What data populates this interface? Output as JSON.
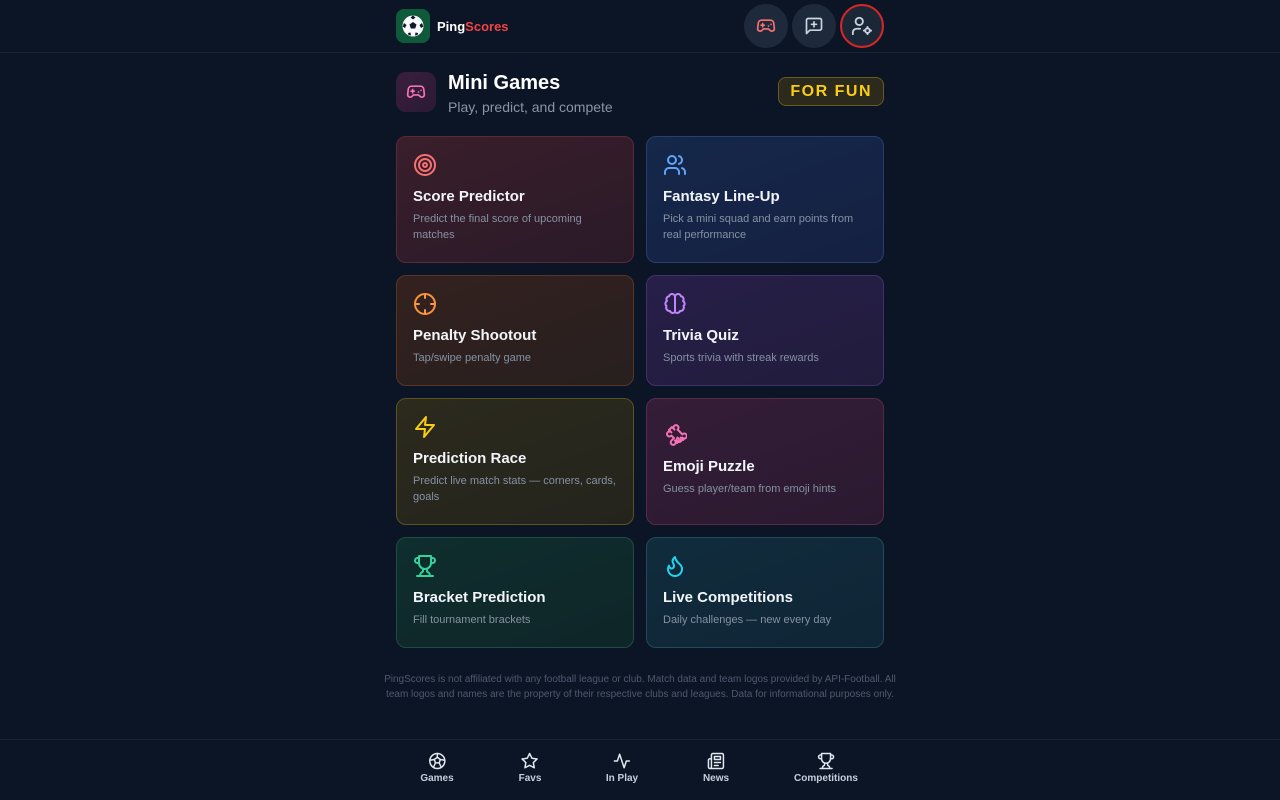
{
  "header": {
    "brand_part1": "Ping",
    "brand_part2": "Scores",
    "actions": [
      {
        "icon": "gamepad-icon",
        "label": ""
      },
      {
        "icon": "message-plus-icon",
        "label": ""
      },
      {
        "icon": "user-settings-icon",
        "label": ""
      }
    ]
  },
  "page": {
    "title": "Mini Games",
    "subtitle": "Play, predict, and compete",
    "badge": "FOR FUN"
  },
  "games": [
    {
      "title": "Score Predictor",
      "description": "Predict the final score of upcoming matches",
      "icon": "target-icon",
      "color": "#f87171"
    },
    {
      "title": "Fantasy Line-Up",
      "description": "Pick a mini squad and earn points from real performance",
      "icon": "users-icon",
      "color": "#60a5fa"
    },
    {
      "title": "Penalty Shootout",
      "description": "Tap/swipe penalty game",
      "icon": "crosshair-icon",
      "color": "#fb923c"
    },
    {
      "title": "Trivia Quiz",
      "description": "Sports trivia with streak rewards",
      "icon": "brain-icon",
      "color": "#c084fc"
    },
    {
      "title": "Prediction Race",
      "description": "Predict live match stats — corners, cards, goals",
      "icon": "zap-icon",
      "color": "#facc15"
    },
    {
      "title": "Emoji Puzzle",
      "description": "Guess player/team from emoji hints",
      "icon": "puzzle-icon",
      "color": "#f472b6"
    },
    {
      "title": "Bracket Prediction",
      "description": "Fill tournament brackets",
      "icon": "trophy-icon",
      "color": "#34d399"
    },
    {
      "title": "Live Competitions",
      "description": "Daily challenges — new every day",
      "icon": "flame-icon",
      "color": "#22d3ee"
    }
  ],
  "disclaimer": "PingScores is not affiliated with any football league or club. Match data and team logos provided by API-Football. All team logos and names are the property of their respective clubs and leagues. Data for informational purposes only.",
  "bottom_nav": [
    {
      "label": "Games",
      "icon": "globe-ball-icon"
    },
    {
      "label": "Favs",
      "icon": "star-icon"
    },
    {
      "label": "In Play",
      "icon": "activity-icon"
    },
    {
      "label": "News",
      "icon": "newspaper-icon"
    },
    {
      "label": "Competitions",
      "icon": "trophy-icon"
    }
  ]
}
